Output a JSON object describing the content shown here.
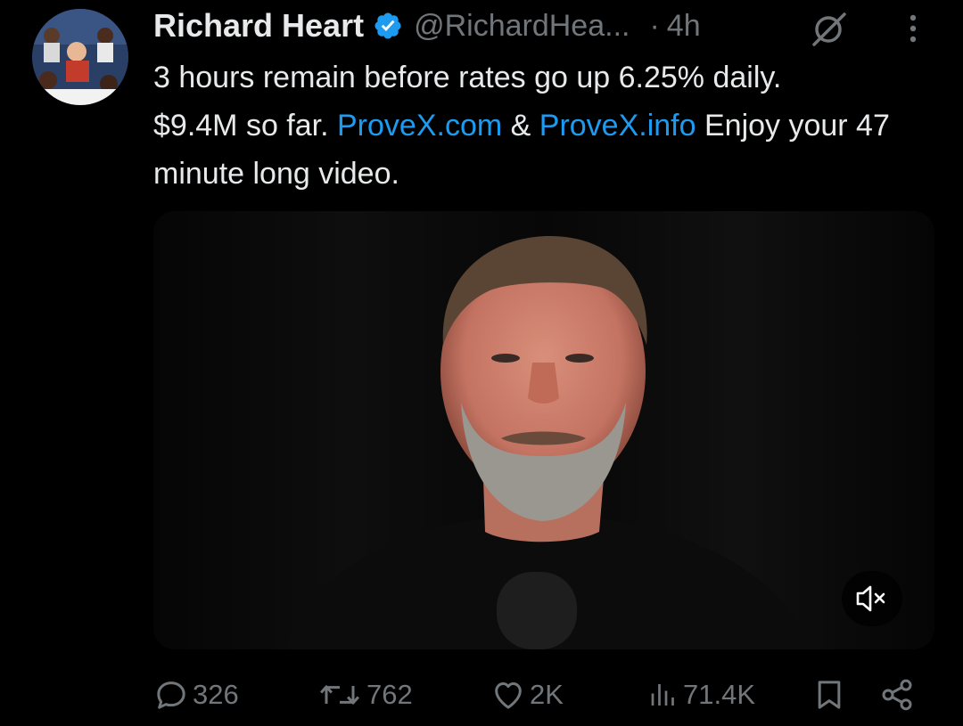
{
  "author": {
    "name": "Richard Heart",
    "handle": "@RichardHea...",
    "separator": "·",
    "time": "4h",
    "verified_icon": "verified-badge-icon",
    "avatar": "avatar-photo"
  },
  "tweet": {
    "line1": "3 hours remain before rates go up 6.25% daily.",
    "text_before_link1": "$9.4M so far. ",
    "link1": "ProveX.com",
    "text_between": " & ",
    "link2": "ProveX.info",
    "text_after": " Enjoy your 47 minute long video."
  },
  "media": {
    "type": "video",
    "muted_icon": "speaker-muted-icon"
  },
  "actions": {
    "replies": "326",
    "reposts": "762",
    "likes": "2K",
    "views": "71.4K"
  },
  "colors": {
    "background": "#000000",
    "text": "#e7e9ea",
    "secondary": "#71767b",
    "link": "#1d9bf0",
    "verified": "#1d9bf0"
  }
}
